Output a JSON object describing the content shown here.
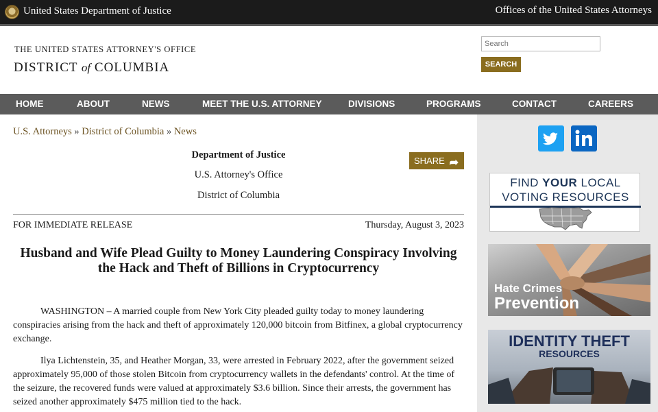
{
  "topbar": {
    "left_title": "United States Department of Justice",
    "right_link": "Offices of the United States Attorneys",
    "seal_icon": "doj-seal-icon"
  },
  "header": {
    "office_line": "THE UNITED STATES ATTORNEY'S OFFICE",
    "district_part1": "DISTRICT",
    "district_of": "of",
    "district_part2": "COLUMBIA"
  },
  "search": {
    "placeholder": "Search",
    "button_label": "SEARCH"
  },
  "nav": {
    "items": [
      "HOME",
      "ABOUT",
      "NEWS",
      "MEET THE U.S. ATTORNEY",
      "DIVISIONS",
      "PROGRAMS",
      "CONTACT",
      "CAREERS"
    ]
  },
  "breadcrumb": {
    "items": [
      "U.S. Attorneys",
      "District of Columbia",
      "News"
    ],
    "separator": "»"
  },
  "article": {
    "dept_line1": "Department of Justice",
    "dept_line2": "U.S. Attorney's Office",
    "dept_line3": "District of Columbia",
    "share_label": "SHARE",
    "release": "FOR IMMEDIATE RELEASE",
    "date": "Thursday, August 3, 2023",
    "headline": "Husband and Wife Plead Guilty to Money Laundering Conspiracy Involving the Hack and Theft of Billions in Cryptocurrency",
    "paragraph1": "WASHINGTON – A married couple from New York City pleaded guilty today to money laundering conspiracies arising from the hack and theft of approximately 120,000 bitcoin from Bitfinex, a global cryptocurrency exchange.",
    "paragraph2": "Ilya Lichtenstein, 35, and Heather Morgan, 33, were arrested in February 2022, after the government seized approximately 95,000 of those stolen Bitcoin from cryptocurrency wallets in the defendants' control. At the time of the seizure, the recovered funds were valued at approximately $3.6 billion. Since their arrests, the government has seized another approximately $475 million tied to the hack."
  },
  "sidebar": {
    "twitter_icon": "twitter-icon",
    "linkedin_icon": "linkedin-icon",
    "vote_line1_a": "FIND ",
    "vote_line1_b": "YOUR",
    "vote_line1_c": " LOCAL",
    "vote_line2": "VOTING RESOURCES",
    "hate_line1": "Hate Crimes",
    "hate_line2": "Prevention",
    "idt_line1": "IDENTITY THEFT",
    "idt_line2": "RESOURCES"
  },
  "colors": {
    "accent_gold": "#8a6d1f",
    "nav_gray": "#5b5b5b",
    "topbar_black": "#1b1b1b",
    "link_brown": "#6b5221"
  }
}
